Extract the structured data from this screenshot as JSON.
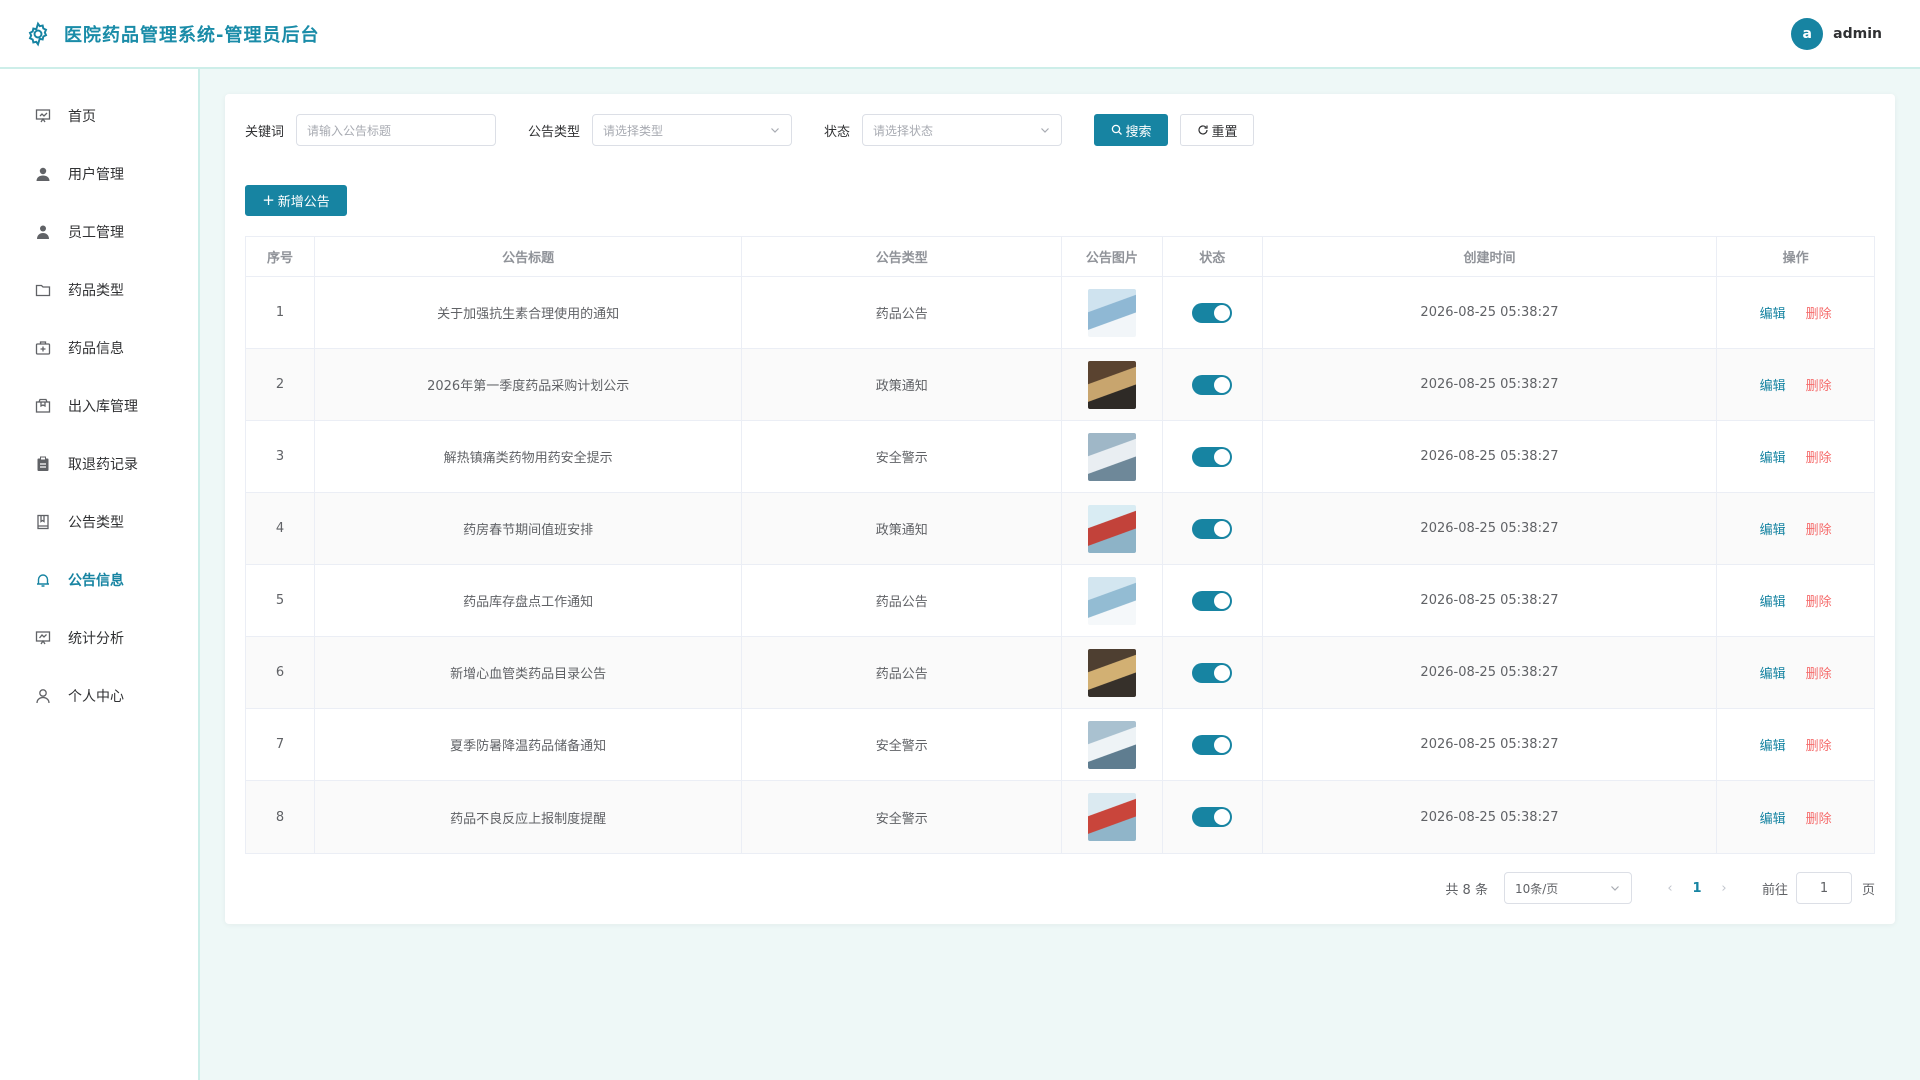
{
  "header": {
    "title": "医院药品管理系统-管理员后台",
    "avatar_letter": "a",
    "username": "admin",
    "accent": "#1784a2"
  },
  "sidebar": {
    "items": [
      {
        "label": "首页",
        "icon": "home-icon"
      },
      {
        "label": "用户管理",
        "icon": "user-icon"
      },
      {
        "label": "员工管理",
        "icon": "staff-icon"
      },
      {
        "label": "药品类型",
        "icon": "folder-icon"
      },
      {
        "label": "药品信息",
        "icon": "medicine-box-icon"
      },
      {
        "label": "出入库管理",
        "icon": "package-icon"
      },
      {
        "label": "取退药记录",
        "icon": "clipboard-icon"
      },
      {
        "label": "公告类型",
        "icon": "notebook-icon"
      },
      {
        "label": "公告信息",
        "icon": "bell-icon",
        "active": true
      },
      {
        "label": "统计分析",
        "icon": "chart-icon"
      },
      {
        "label": "个人中心",
        "icon": "profile-icon"
      }
    ]
  },
  "filters": {
    "keyword_label": "关键词",
    "keyword_placeholder": "请输入公告标题",
    "type_label": "公告类型",
    "type_placeholder": "请选择类型",
    "status_label": "状态",
    "status_placeholder": "请选择状态",
    "search_label": "搜索",
    "reset_label": "重置"
  },
  "add_button_label": "新增公告",
  "table": {
    "headers": [
      "序号",
      "公告标题",
      "公告类型",
      "公告图片",
      "状态",
      "创建时间",
      "操作"
    ],
    "edit_label": "编辑",
    "delete_label": "删除",
    "rows": [
      {
        "no": "1",
        "title": "关于加强抗生素合理使用的通知",
        "type": "药品公告",
        "time": "2026-08-25 05:38:27",
        "enabled": true
      },
      {
        "no": "2",
        "title": "2026年第一季度药品采购计划公示",
        "type": "政策通知",
        "time": "2026-08-25 05:38:27",
        "enabled": true
      },
      {
        "no": "3",
        "title": "解热镇痛类药物用药安全提示",
        "type": "安全警示",
        "time": "2026-08-25 05:38:27",
        "enabled": true
      },
      {
        "no": "4",
        "title": "药房春节期间值班安排",
        "type": "政策通知",
        "time": "2026-08-25 05:38:27",
        "enabled": true
      },
      {
        "no": "5",
        "title": "药品库存盘点工作通知",
        "type": "药品公告",
        "time": "2026-08-25 05:38:27",
        "enabled": true
      },
      {
        "no": "6",
        "title": "新增心血管类药品目录公告",
        "type": "药品公告",
        "time": "2026-08-25 05:38:27",
        "enabled": true
      },
      {
        "no": "7",
        "title": "夏季防暑降温药品储备通知",
        "type": "安全警示",
        "time": "2026-08-25 05:38:27",
        "enabled": true
      },
      {
        "no": "8",
        "title": "药品不良反应上报制度提醒",
        "type": "安全警示",
        "time": "2026-08-25 05:38:27",
        "enabled": true
      }
    ]
  },
  "pagination": {
    "total_text": "共 8 条",
    "page_size": "10条/页",
    "current_page": "1",
    "goto_label": "前往",
    "goto_value": "1",
    "page_suffix": "页"
  }
}
